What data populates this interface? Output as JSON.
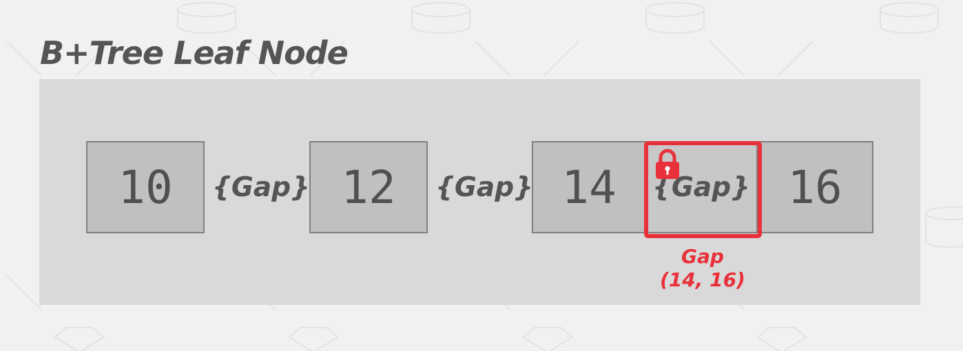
{
  "title": "B+Tree Leaf Node",
  "keys": [
    "10",
    "12",
    "14",
    "16"
  ],
  "gaps": [
    "{Gap}",
    "{Gap}",
    "{Gap}"
  ],
  "locked_gap": {
    "caption_line1": "Gap",
    "caption_line2": "(14, 16)",
    "icon": "lock-icon",
    "color": "#e8313a"
  },
  "colors": {
    "background": "#f1f1f1",
    "panel": "#d9d9d9",
    "key_fill": "#c0c0c0",
    "key_border": "#7f7f7f",
    "text": "#555555",
    "highlight": "#e8313a"
  }
}
